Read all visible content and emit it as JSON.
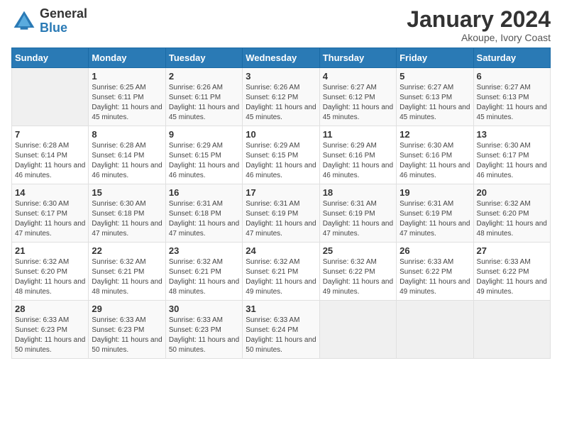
{
  "logo": {
    "general": "General",
    "blue": "Blue"
  },
  "title": "January 2024",
  "subtitle": "Akoupe, Ivory Coast",
  "days_header": [
    "Sunday",
    "Monday",
    "Tuesday",
    "Wednesday",
    "Thursday",
    "Friday",
    "Saturday"
  ],
  "weeks": [
    [
      {
        "num": "",
        "info": ""
      },
      {
        "num": "1",
        "info": "Sunrise: 6:25 AM\nSunset: 6:11 PM\nDaylight: 11 hours and 45 minutes."
      },
      {
        "num": "2",
        "info": "Sunrise: 6:26 AM\nSunset: 6:11 PM\nDaylight: 11 hours and 45 minutes."
      },
      {
        "num": "3",
        "info": "Sunrise: 6:26 AM\nSunset: 6:12 PM\nDaylight: 11 hours and 45 minutes."
      },
      {
        "num": "4",
        "info": "Sunrise: 6:27 AM\nSunset: 6:12 PM\nDaylight: 11 hours and 45 minutes."
      },
      {
        "num": "5",
        "info": "Sunrise: 6:27 AM\nSunset: 6:13 PM\nDaylight: 11 hours and 45 minutes."
      },
      {
        "num": "6",
        "info": "Sunrise: 6:27 AM\nSunset: 6:13 PM\nDaylight: 11 hours and 45 minutes."
      }
    ],
    [
      {
        "num": "7",
        "info": "Sunrise: 6:28 AM\nSunset: 6:14 PM\nDaylight: 11 hours and 46 minutes."
      },
      {
        "num": "8",
        "info": "Sunrise: 6:28 AM\nSunset: 6:14 PM\nDaylight: 11 hours and 46 minutes."
      },
      {
        "num": "9",
        "info": "Sunrise: 6:29 AM\nSunset: 6:15 PM\nDaylight: 11 hours and 46 minutes."
      },
      {
        "num": "10",
        "info": "Sunrise: 6:29 AM\nSunset: 6:15 PM\nDaylight: 11 hours and 46 minutes."
      },
      {
        "num": "11",
        "info": "Sunrise: 6:29 AM\nSunset: 6:16 PM\nDaylight: 11 hours and 46 minutes."
      },
      {
        "num": "12",
        "info": "Sunrise: 6:30 AM\nSunset: 6:16 PM\nDaylight: 11 hours and 46 minutes."
      },
      {
        "num": "13",
        "info": "Sunrise: 6:30 AM\nSunset: 6:17 PM\nDaylight: 11 hours and 46 minutes."
      }
    ],
    [
      {
        "num": "14",
        "info": "Sunrise: 6:30 AM\nSunset: 6:17 PM\nDaylight: 11 hours and 47 minutes."
      },
      {
        "num": "15",
        "info": "Sunrise: 6:30 AM\nSunset: 6:18 PM\nDaylight: 11 hours and 47 minutes."
      },
      {
        "num": "16",
        "info": "Sunrise: 6:31 AM\nSunset: 6:18 PM\nDaylight: 11 hours and 47 minutes."
      },
      {
        "num": "17",
        "info": "Sunrise: 6:31 AM\nSunset: 6:19 PM\nDaylight: 11 hours and 47 minutes."
      },
      {
        "num": "18",
        "info": "Sunrise: 6:31 AM\nSunset: 6:19 PM\nDaylight: 11 hours and 47 minutes."
      },
      {
        "num": "19",
        "info": "Sunrise: 6:31 AM\nSunset: 6:19 PM\nDaylight: 11 hours and 47 minutes."
      },
      {
        "num": "20",
        "info": "Sunrise: 6:32 AM\nSunset: 6:20 PM\nDaylight: 11 hours and 48 minutes."
      }
    ],
    [
      {
        "num": "21",
        "info": "Sunrise: 6:32 AM\nSunset: 6:20 PM\nDaylight: 11 hours and 48 minutes."
      },
      {
        "num": "22",
        "info": "Sunrise: 6:32 AM\nSunset: 6:21 PM\nDaylight: 11 hours and 48 minutes."
      },
      {
        "num": "23",
        "info": "Sunrise: 6:32 AM\nSunset: 6:21 PM\nDaylight: 11 hours and 48 minutes."
      },
      {
        "num": "24",
        "info": "Sunrise: 6:32 AM\nSunset: 6:21 PM\nDaylight: 11 hours and 49 minutes."
      },
      {
        "num": "25",
        "info": "Sunrise: 6:32 AM\nSunset: 6:22 PM\nDaylight: 11 hours and 49 minutes."
      },
      {
        "num": "26",
        "info": "Sunrise: 6:33 AM\nSunset: 6:22 PM\nDaylight: 11 hours and 49 minutes."
      },
      {
        "num": "27",
        "info": "Sunrise: 6:33 AM\nSunset: 6:22 PM\nDaylight: 11 hours and 49 minutes."
      }
    ],
    [
      {
        "num": "28",
        "info": "Sunrise: 6:33 AM\nSunset: 6:23 PM\nDaylight: 11 hours and 50 minutes."
      },
      {
        "num": "29",
        "info": "Sunrise: 6:33 AM\nSunset: 6:23 PM\nDaylight: 11 hours and 50 minutes."
      },
      {
        "num": "30",
        "info": "Sunrise: 6:33 AM\nSunset: 6:23 PM\nDaylight: 11 hours and 50 minutes."
      },
      {
        "num": "31",
        "info": "Sunrise: 6:33 AM\nSunset: 6:24 PM\nDaylight: 11 hours and 50 minutes."
      },
      {
        "num": "",
        "info": ""
      },
      {
        "num": "",
        "info": ""
      },
      {
        "num": "",
        "info": ""
      }
    ]
  ]
}
